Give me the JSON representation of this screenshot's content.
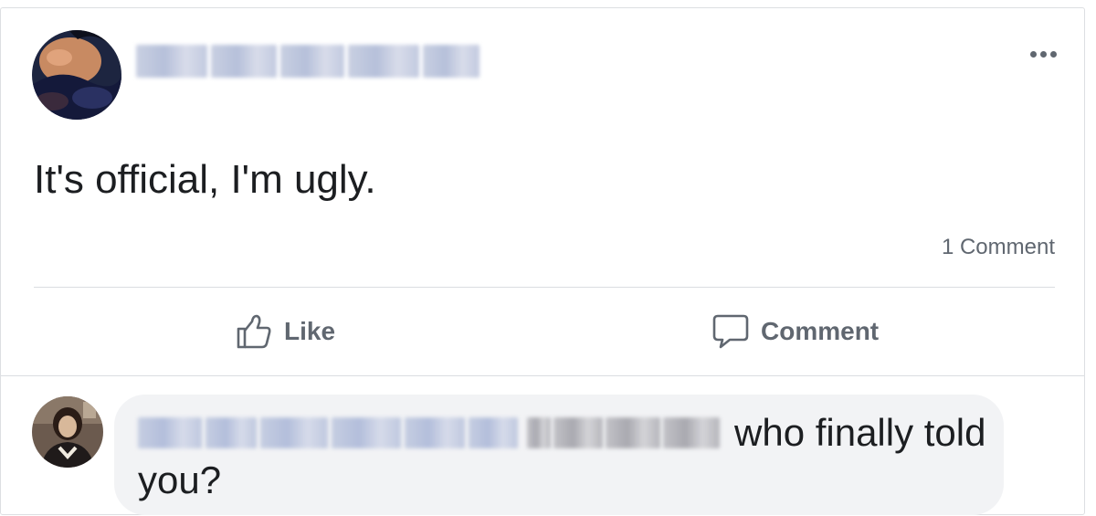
{
  "post": {
    "text": "It's official, I'm ugly.",
    "comment_count": "1 Comment",
    "author_avatar_icon": "profile-photo",
    "more_icon": "more-horizontal-icon"
  },
  "actions": {
    "like_label": "Like",
    "comment_label": "Comment",
    "like_icon": "thumbs-up-icon",
    "comment_icon": "speech-bubble-icon"
  },
  "comment": {
    "text_line1": "who finally told",
    "text_line2": "you?"
  },
  "colors": {
    "text": "#1c1e21",
    "secondary_text": "#606770",
    "bubble_bg": "#f2f3f5",
    "divider": "#dadde1",
    "border": "#dddfe2"
  }
}
